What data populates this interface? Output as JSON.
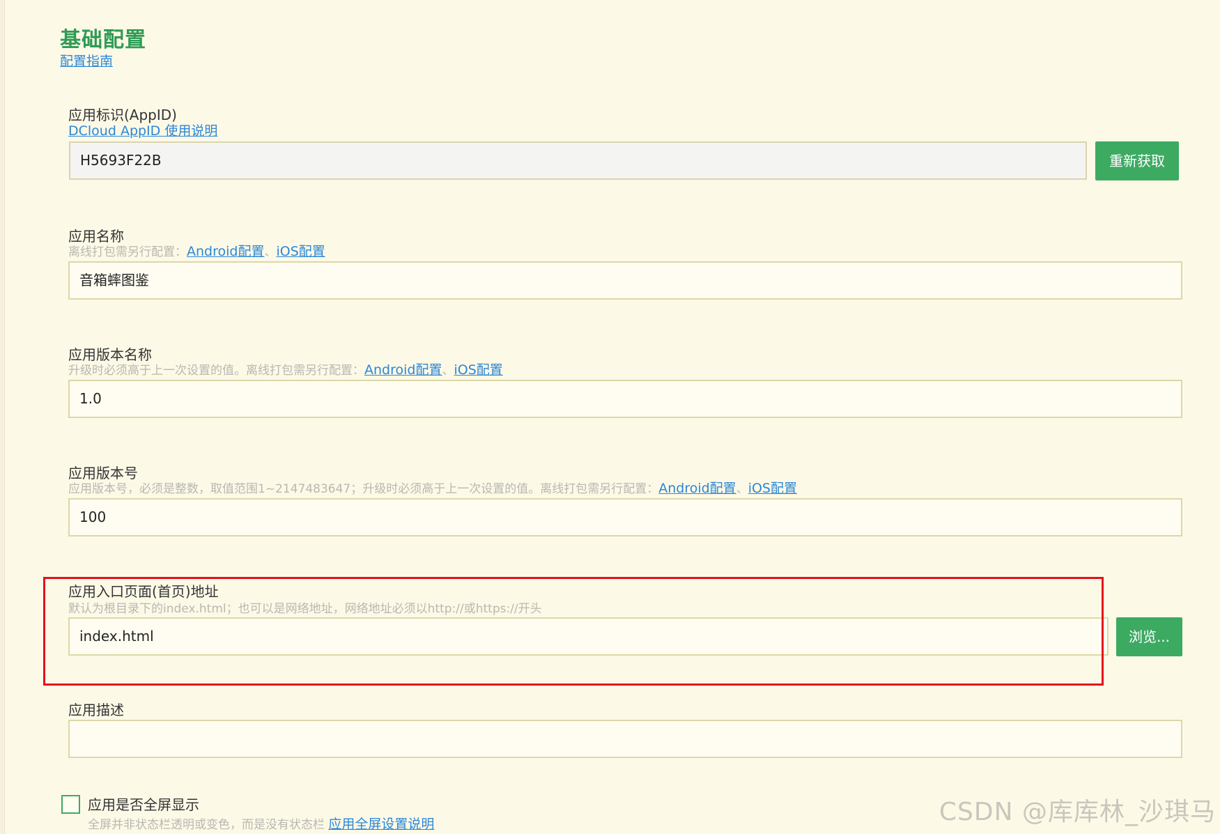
{
  "section": {
    "title": "基础配置",
    "guide_link": "配置指南"
  },
  "appid": {
    "label": "应用标识(AppID)",
    "hint_link": "DCloud AppID 使用说明",
    "value": "H5693F22B",
    "button": "重新获取"
  },
  "app_name": {
    "label": "应用名称",
    "hint": "离线打包需另行配置：",
    "android_link": "Android配置",
    "sep": "、",
    "ios_link": "iOS配置",
    "value": "音箱蟀图鉴"
  },
  "version_name": {
    "label": "应用版本名称",
    "hint": "升级时必须高于上一次设置的值。离线打包需另行配置：",
    "android_link": "Android配置",
    "sep": "、",
    "ios_link": "iOS配置",
    "value": "1.0"
  },
  "version_code": {
    "label": "应用版本号",
    "hint": "应用版本号，必须是整数，取值范围1~2147483647；升级时必须高于上一次设置的值。离线打包需另行配置：",
    "android_link": "Android配置",
    "sep": "、",
    "ios_link": "iOS配置",
    "value": "100"
  },
  "entry_page": {
    "label": "应用入口页面(首页)地址",
    "hint": "默认为根目录下的index.html；也可以是网络地址，网络地址必须以http://或https://开头",
    "value": "index.html",
    "button": "浏览..."
  },
  "description": {
    "label": "应用描述",
    "value": ""
  },
  "fullscreen": {
    "label": "应用是否全屏显示",
    "hint": "全屏并非状态栏透明或变色，而是没有状态栏 ",
    "link": "应用全屏设置说明",
    "checked": false
  },
  "watermark": "CSDN @库库林_沙琪马",
  "colors": {
    "background": "#fdf9e7",
    "accent_green": "#3daa62",
    "link_blue": "#2b87d6",
    "highlight_red": "#e3121b"
  }
}
